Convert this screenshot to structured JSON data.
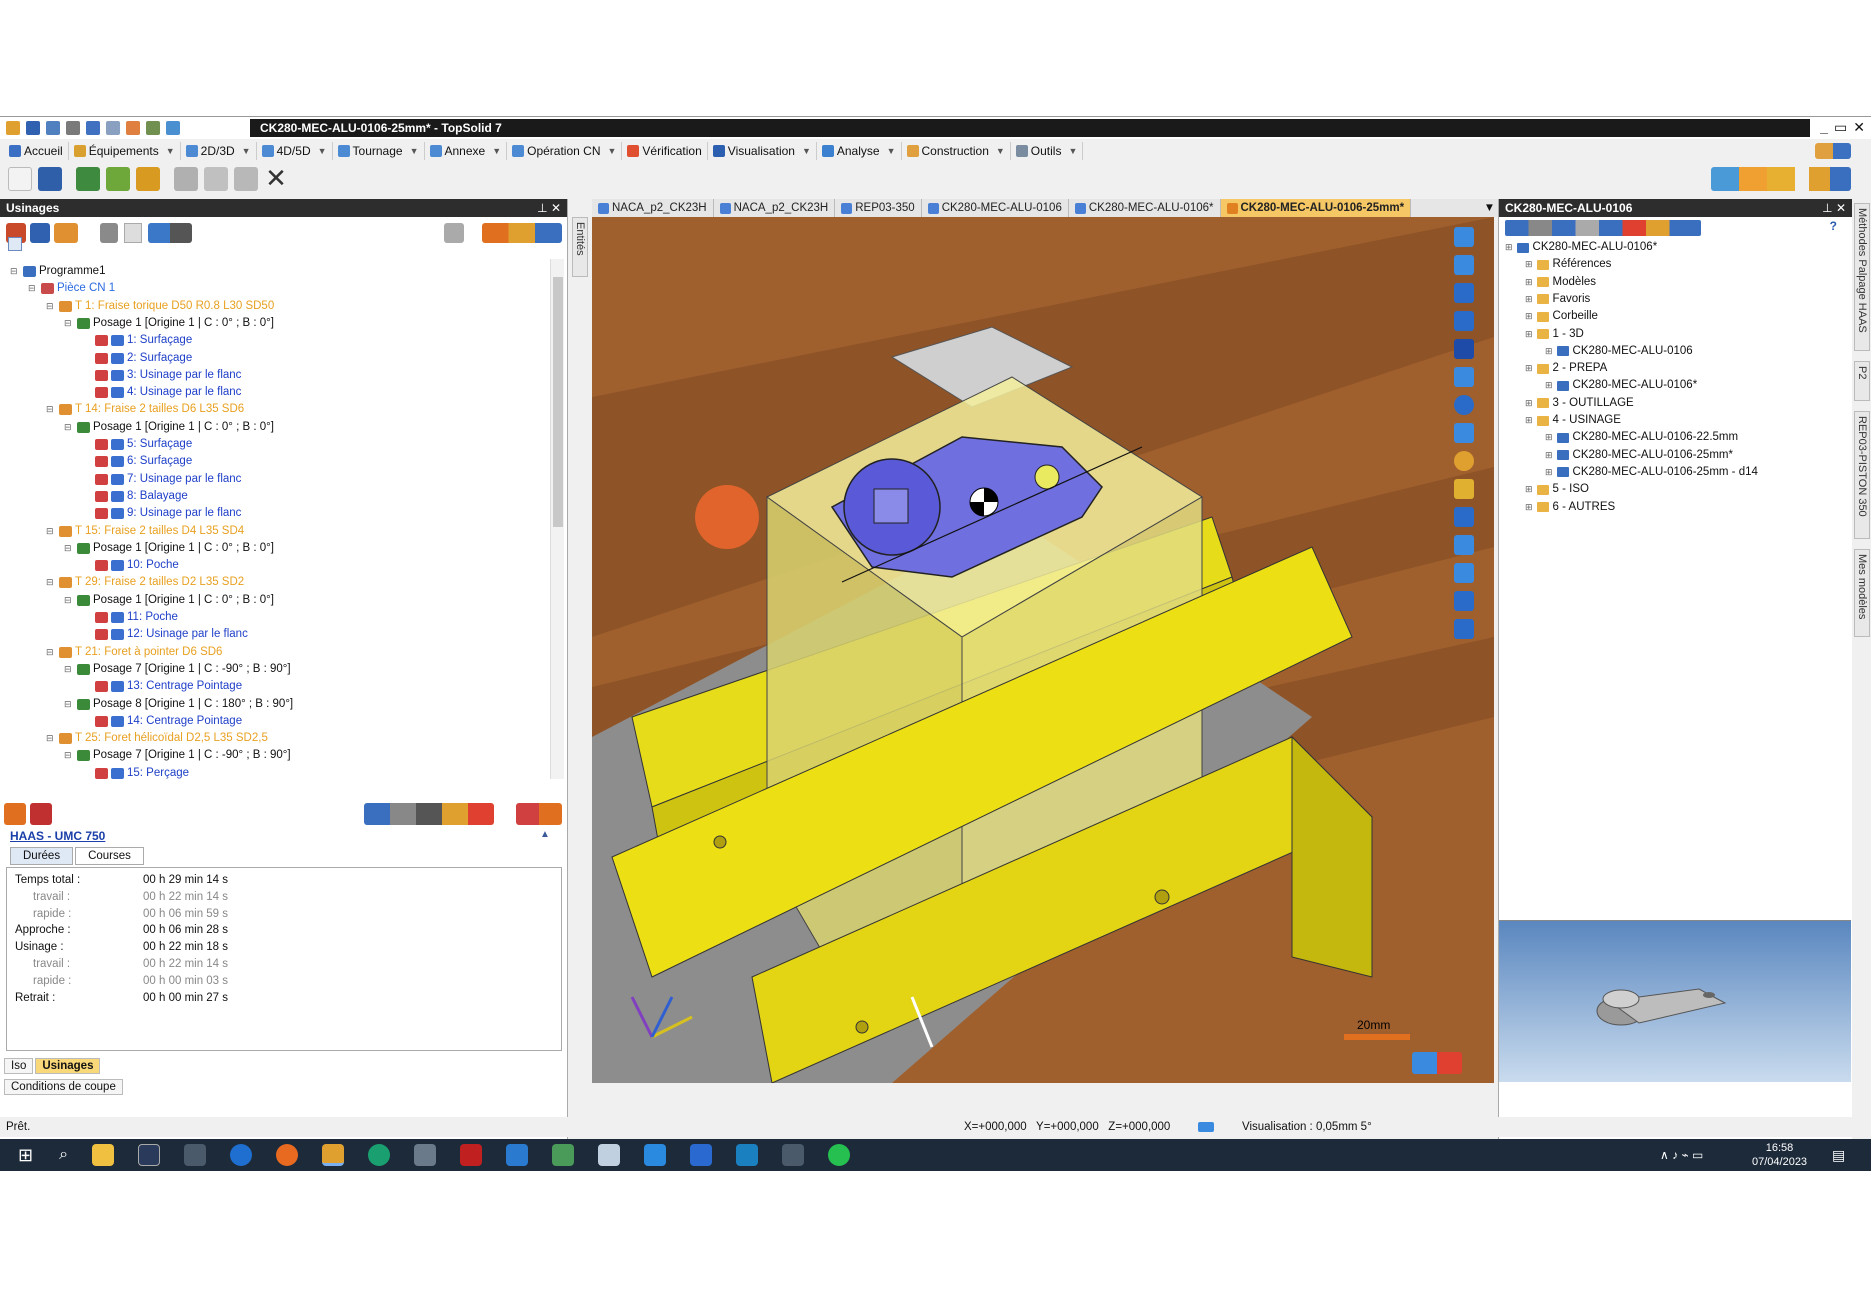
{
  "window": {
    "title": "CK280-MEC-ALU-0106-25mm* - TopSolid 7"
  },
  "ribbon": {
    "tabs": [
      "Accueil",
      "Équipements",
      "2D/3D",
      "4D/5D",
      "Tournage",
      "Annexe",
      "Opération CN",
      "Vérification",
      "Visualisation",
      "Analyse",
      "Construction",
      "Outils"
    ]
  },
  "left_panel": {
    "title": "Usinages",
    "tree": [
      {
        "label": "Programme1",
        "kind": "prog",
        "indent": 0
      },
      {
        "label": "Pièce CN 1",
        "kind": "piece",
        "indent": 1
      },
      {
        "label": "T 1: Fraise torique D50 R0.8 L30 SD50",
        "kind": "tool",
        "indent": 2
      },
      {
        "label": "Posage 1 [Origine 1 | C : 0° ; B : 0°]",
        "kind": "pos",
        "indent": 3
      },
      {
        "label": "1: Surfaçage",
        "kind": "op",
        "indent": 4
      },
      {
        "label": "2: Surfaçage",
        "kind": "op",
        "indent": 4
      },
      {
        "label": "3: Usinage par le flanc",
        "kind": "op",
        "indent": 4
      },
      {
        "label": "4: Usinage par le flanc",
        "kind": "op",
        "indent": 4
      },
      {
        "label": "T 14: Fraise 2 tailles D6 L35 SD6",
        "kind": "tool",
        "indent": 2
      },
      {
        "label": "Posage 1 [Origine 1 | C : 0° ; B : 0°]",
        "kind": "pos",
        "indent": 3
      },
      {
        "label": "5: Surfaçage",
        "kind": "op",
        "indent": 4
      },
      {
        "label": "6: Surfaçage",
        "kind": "op",
        "indent": 4
      },
      {
        "label": "7: Usinage par le flanc",
        "kind": "op",
        "indent": 4
      },
      {
        "label": "8: Balayage",
        "kind": "op",
        "indent": 4
      },
      {
        "label": "9: Usinage par le flanc",
        "kind": "op",
        "indent": 4
      },
      {
        "label": "T 15: Fraise 2 tailles D4 L35 SD4",
        "kind": "tool",
        "indent": 2
      },
      {
        "label": "Posage 1 [Origine 1 | C : 0° ; B : 0°]",
        "kind": "pos",
        "indent": 3
      },
      {
        "label": "10: Poche",
        "kind": "op",
        "indent": 4
      },
      {
        "label": "T 29: Fraise 2 tailles D2 L35 SD2",
        "kind": "tool",
        "indent": 2
      },
      {
        "label": "Posage 1 [Origine 1 | C : 0° ; B : 0°]",
        "kind": "pos",
        "indent": 3
      },
      {
        "label": "11: Poche",
        "kind": "op",
        "indent": 4
      },
      {
        "label": "12: Usinage par le flanc",
        "kind": "op",
        "indent": 4
      },
      {
        "label": "T 21: Foret à pointer D6 SD6",
        "kind": "tool",
        "indent": 2
      },
      {
        "label": "Posage 7 [Origine 1 | C : -90° ; B : 90°]",
        "kind": "pos",
        "indent": 3
      },
      {
        "label": "13: Centrage Pointage",
        "kind": "op",
        "indent": 4
      },
      {
        "label": "Posage 8 [Origine 1 | C : 180° ; B : 90°]",
        "kind": "pos",
        "indent": 3
      },
      {
        "label": "14: Centrage Pointage",
        "kind": "op",
        "indent": 4
      },
      {
        "label": "T 25: Foret hélicoïdal D2,5 L35 SD2,5",
        "kind": "tool",
        "indent": 2
      },
      {
        "label": "Posage 7 [Origine 1 | C : -90° ; B : 90°]",
        "kind": "pos",
        "indent": 3
      },
      {
        "label": "15: Perçage",
        "kind": "op",
        "indent": 4
      }
    ],
    "machine": "HAAS - UMC 750",
    "tabs": [
      "Durées",
      "Courses"
    ],
    "durations": [
      {
        "label": "Temps total :",
        "value": "00 h 29 min 14 s",
        "sub": false
      },
      {
        "label": "travail :",
        "value": "00 h 22 min 14 s",
        "sub": true
      },
      {
        "label": "rapide :",
        "value": "00 h 06 min 59 s",
        "sub": true
      },
      {
        "label": "Approche :",
        "value": "00 h 06 min 28 s",
        "sub": false
      },
      {
        "label": "Usinage :",
        "value": "00 h 22 min 18 s",
        "sub": false
      },
      {
        "label": "travail :",
        "value": "00 h 22 min 14 s",
        "sub": true
      },
      {
        "label": "rapide :",
        "value": "00 h 00 min 03 s",
        "sub": true
      },
      {
        "label": "Retrait :",
        "value": "00 h 00 min 27 s",
        "sub": false
      }
    ],
    "bottom_tabs": [
      "Iso",
      "Usinages"
    ],
    "cond_tab": "Conditions de coupe"
  },
  "doc_tabs": [
    "NACA_p2_CK23H",
    "NACA_p2_CK23H",
    "REP03-350",
    "CK280-MEC-ALU-0106",
    "CK280-MEC-ALU-0106*",
    "CK280-MEC-ALU-0106-25mm*"
  ],
  "viewport": {
    "scale_label": "20mm",
    "side_tab": "Entités"
  },
  "right_panel": {
    "title": "CK280-MEC-ALU-0106",
    "tree": [
      {
        "label": "CK280-MEC-ALU-0106*",
        "indent": 0
      },
      {
        "label": "Références",
        "indent": 1
      },
      {
        "label": "Modèles",
        "indent": 1
      },
      {
        "label": "Favoris",
        "indent": 1
      },
      {
        "label": "Corbeille",
        "indent": 1
      },
      {
        "label": "1 - 3D",
        "indent": 1
      },
      {
        "label": "CK280-MEC-ALU-0106",
        "indent": 2
      },
      {
        "label": "2 - PREPA",
        "indent": 1
      },
      {
        "label": "CK280-MEC-ALU-0106*",
        "indent": 2
      },
      {
        "label": "3 - OUTILLAGE",
        "indent": 1
      },
      {
        "label": "4 - USINAGE",
        "indent": 1
      },
      {
        "label": "CK280-MEC-ALU-0106-22.5mm",
        "indent": 2
      },
      {
        "label": "CK280-MEC-ALU-0106-25mm*",
        "indent": 2
      },
      {
        "label": "CK280-MEC-ALU-0106-25mm - d14",
        "indent": 2
      },
      {
        "label": "5 - ISO",
        "indent": 1
      },
      {
        "label": "6 - AUTRES",
        "indent": 1
      }
    ],
    "side_tabs": [
      "Méthodes Palpage HAAS",
      "P2",
      "REP03-PISTON 350",
      "Mes modèles"
    ]
  },
  "status": {
    "ready": "Prêt.",
    "coords": "X=+000,000   Y=+000,000   Z=+000,000",
    "visu": "Visualisation : 0,05mm 5°"
  },
  "taskbar": {
    "time": "16:58",
    "date": "07/04/2023"
  }
}
